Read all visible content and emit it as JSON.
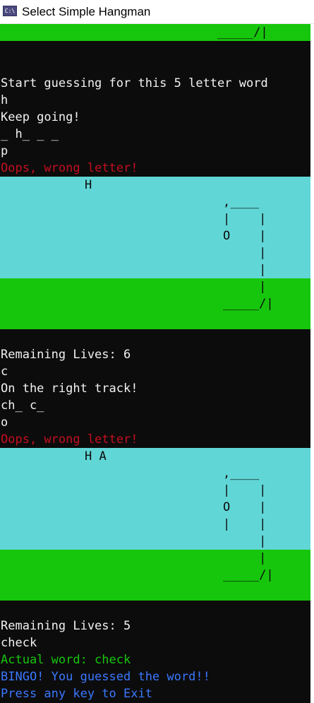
{
  "window": {
    "title": "Select Simple Hangman",
    "icon": "C:\\"
  },
  "top_art": {
    "ground": "_____/|"
  },
  "lines": {
    "intro": "Start guessing for this 5 letter word",
    "guess1": "h",
    "msg1": "Keep going!",
    "word1": "_ h_ _ _",
    "guess2": "p",
    "msg2": "Oops, wrong letter!",
    "lives1": "Remaining Lives: 6",
    "guess3": "c",
    "msg3": "On the right track!",
    "word2": "ch_ c_",
    "guess4": "o",
    "msg4": "Oops, wrong letter!",
    "lives2": "Remaining Lives: 5",
    "final_guess": "check",
    "actual_word": "Actual word: check",
    "bingo": "BINGO! You guessed the word!!",
    "exit": "Press any key to Exit"
  },
  "hangman1": {
    "letters": "H",
    "art": ",____\n|    |\nO    |\n     |\n     |\n     |\n_____/|"
  },
  "hangman2": {
    "letters": "H A",
    "art": ",____\n|    |\nO    |\n|    |\n     |\n     |\n_____/|"
  },
  "colors": {
    "console_bg": "#0c0c0c",
    "text": "#f2f2f2",
    "red": "#c50f1f",
    "green": "#16c60c",
    "blue": "#3b78ff",
    "cyan": "#61d6d6"
  }
}
